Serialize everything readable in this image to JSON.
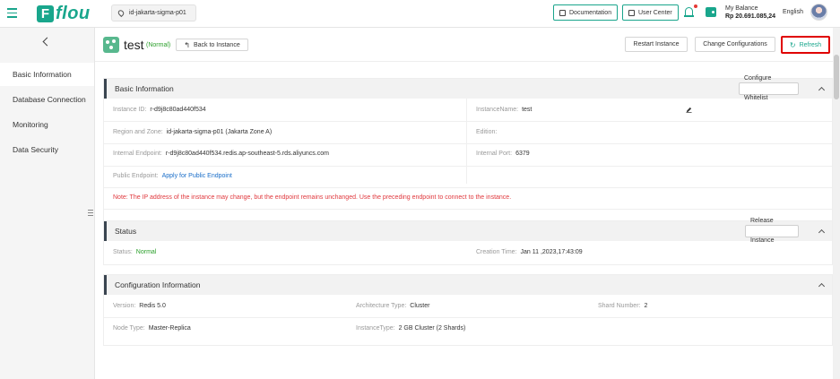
{
  "topbar": {
    "logo_letter": "F",
    "logo_text": "flou",
    "region": "id-jakarta-sigma-p01",
    "documentation": "Documentation",
    "user_center": "User Center",
    "balance_label": "My Balance",
    "balance_amount": "Rp 20.691.085,24",
    "language": "English"
  },
  "sidebar": {
    "items": [
      {
        "label": "Basic Information"
      },
      {
        "label": "Database Connection"
      },
      {
        "label": "Monitoring"
      },
      {
        "label": "Data Security"
      }
    ]
  },
  "header": {
    "title": "test",
    "status": "(Normal)",
    "back_label": "Back to Instance",
    "restart_label": "Restart Instance",
    "change_config_label": "Change Configurations",
    "refresh_label": "Refresh"
  },
  "basic": {
    "title": "Basic Information",
    "whitelist_label": "Configure Whitelist",
    "instance_id_label": "Instance ID:",
    "instance_id": "r-d9j8c80ad440f534",
    "instance_name_label": "InstanceName:",
    "instance_name": "test",
    "region_label": "Region and Zone:",
    "region_value": "id-jakarta-sigma-p01 (Jakarta Zone A)",
    "edition_label": "Edition:",
    "internal_endpoint_label": "Internal Endpoint:",
    "internal_endpoint": "r-d9j8c80ad440f534.redis.ap-southeast-5.rds.aliyuncs.com",
    "internal_port_label": "Internal Port:",
    "internal_port": "6379",
    "public_endpoint_label": "Public Endpoint:",
    "public_endpoint_link": "Apply for Public Endpoint",
    "note": "Note:  The IP address of the instance may change, but the endpoint remains unchanged. Use the preceding endpoint to connect to the instance."
  },
  "status": {
    "title": "Status",
    "release_label": "Release Instance",
    "status_label": "Status:",
    "status_value": "Normal",
    "creation_label": "Creation Time:",
    "creation_value": "Jan 11 ,2023,17:43:09"
  },
  "config": {
    "title": "Configuration Information",
    "version_label": "Version:",
    "version_value": "Redis 5.0",
    "arch_label": "Architecture Type:",
    "arch_value": "Cluster",
    "shard_label": "Shard Number:",
    "shard_value": "2",
    "node_label": "Node Type:",
    "node_value": "Master-Replica",
    "instance_type_label": "InstanceType:",
    "instance_type_value": "2 GB Cluster (2 Shards)"
  },
  "colors": {
    "brand": "#19a68c",
    "normal_status": "#2ca02c",
    "highlight_border": "#e00000",
    "note_text": "#e0393e",
    "link": "#1a6ec9"
  }
}
